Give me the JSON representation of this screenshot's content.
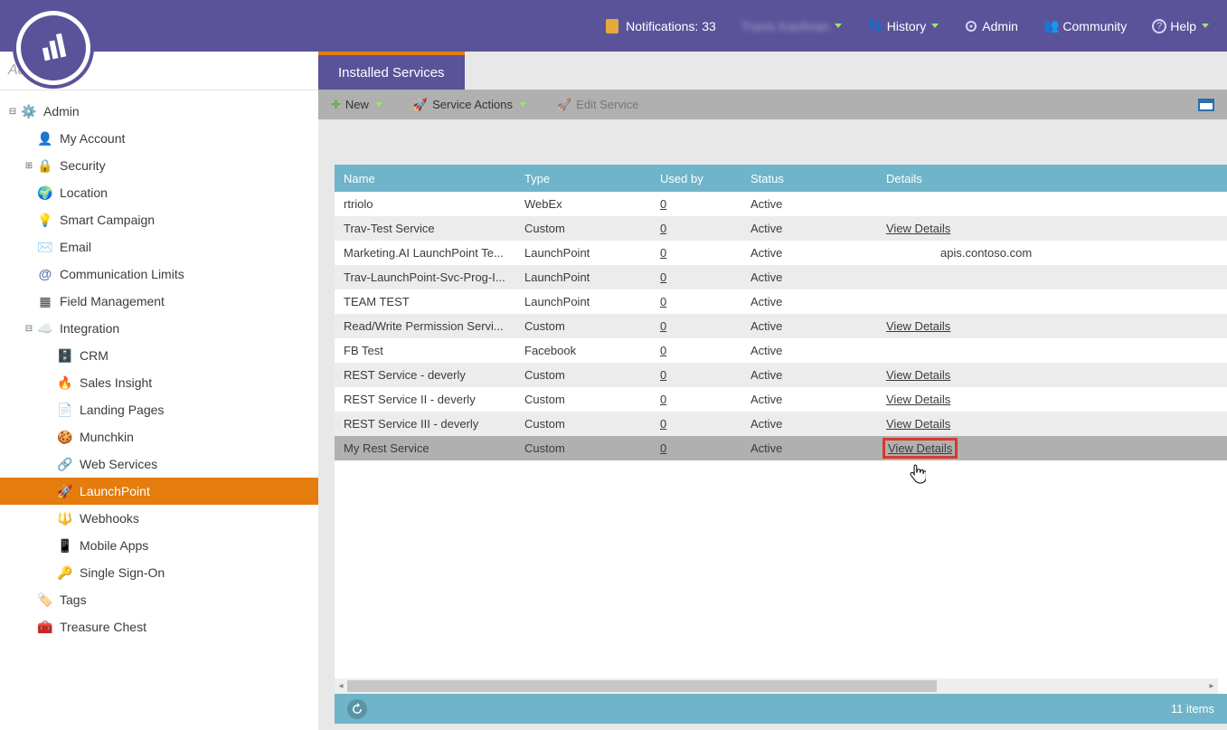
{
  "topnav": {
    "notifications_label": "Notifications: 33",
    "username": "Travis Kaufman",
    "history_label": "History",
    "admin_label": "Admin",
    "community_label": "Community",
    "help_label": "Help"
  },
  "search_placeholder": "Admin...",
  "tree": [
    {
      "level": 0,
      "expander": "minus",
      "icon": "gear",
      "label": "Admin"
    },
    {
      "level": 1,
      "expander": "none",
      "icon": "user",
      "label": "My Account"
    },
    {
      "level": 1,
      "expander": "plus",
      "icon": "lock",
      "label": "Security"
    },
    {
      "level": 1,
      "expander": "none",
      "icon": "globe",
      "label": "Location"
    },
    {
      "level": 1,
      "expander": "none",
      "icon": "bulb",
      "label": "Smart Campaign"
    },
    {
      "level": 1,
      "expander": "none",
      "icon": "mail",
      "label": "Email"
    },
    {
      "level": 1,
      "expander": "none",
      "icon": "at",
      "label": "Communication Limits"
    },
    {
      "level": 1,
      "expander": "none",
      "icon": "fields",
      "label": "Field Management"
    },
    {
      "level": 1,
      "expander": "minus",
      "icon": "cloud",
      "label": "Integration"
    },
    {
      "level": 2,
      "expander": "none",
      "icon": "db",
      "label": "CRM"
    },
    {
      "level": 2,
      "expander": "none",
      "icon": "fire",
      "label": "Sales Insight"
    },
    {
      "level": 2,
      "expander": "none",
      "icon": "page",
      "label": "Landing Pages"
    },
    {
      "level": 2,
      "expander": "none",
      "icon": "munchkin",
      "label": "Munchkin"
    },
    {
      "level": 2,
      "expander": "none",
      "icon": "web",
      "label": "Web Services"
    },
    {
      "level": 2,
      "expander": "none",
      "icon": "rocket",
      "label": "LaunchPoint",
      "selected": true
    },
    {
      "level": 2,
      "expander": "none",
      "icon": "hook",
      "label": "Webhooks"
    },
    {
      "level": 2,
      "expander": "none",
      "icon": "mobile",
      "label": "Mobile Apps"
    },
    {
      "level": 2,
      "expander": "none",
      "icon": "key",
      "label": "Single Sign-On"
    },
    {
      "level": 1,
      "expander": "none",
      "icon": "tag",
      "label": "Tags"
    },
    {
      "level": 1,
      "expander": "none",
      "icon": "chest",
      "label": "Treasure Chest"
    }
  ],
  "tab_title": "Installed Services",
  "toolbar": {
    "new_label": "New",
    "actions_label": "Service Actions",
    "edit_label": "Edit Service"
  },
  "grid": {
    "columns": [
      "Name",
      "Type",
      "Used by",
      "Status",
      "Details"
    ],
    "rows": [
      {
        "name": "rtriolo",
        "type": "WebEx",
        "used": "0",
        "status": "Active",
        "details": ""
      },
      {
        "name": "Trav-Test Service",
        "type": "Custom",
        "used": "0",
        "status": "Active",
        "details": "View Details"
      },
      {
        "name": "Marketing.AI LaunchPoint Te...",
        "type": "LaunchPoint",
        "used": "0",
        "status": "Active",
        "details": "apis.contoso.com"
      },
      {
        "name": "Trav-LaunchPoint-Svc-Prog-I...",
        "type": "LaunchPoint",
        "used": "0",
        "status": "Active",
        "details": ""
      },
      {
        "name": "TEAM TEST",
        "type": "LaunchPoint",
        "used": "0",
        "status": "Active",
        "details": ""
      },
      {
        "name": "Read/Write Permission Servi...",
        "type": "Custom",
        "used": "0",
        "status": "Active",
        "details": "View Details"
      },
      {
        "name": "FB Test",
        "type": "Facebook",
        "used": "0",
        "status": "Active",
        "details": ""
      },
      {
        "name": "REST Service - deverly",
        "type": "Custom",
        "used": "0",
        "status": "Active",
        "details": "View Details"
      },
      {
        "name": "REST Service II - deverly",
        "type": "Custom",
        "used": "0",
        "status": "Active",
        "details": "View Details"
      },
      {
        "name": "REST Service III - deverly",
        "type": "Custom",
        "used": "0",
        "status": "Active",
        "details": "View Details"
      },
      {
        "name": "My Rest Service",
        "type": "Custom",
        "used": "0",
        "status": "Active",
        "details": "View Details",
        "selected": true,
        "highlight": true
      }
    ]
  },
  "footer_count": "11 items"
}
